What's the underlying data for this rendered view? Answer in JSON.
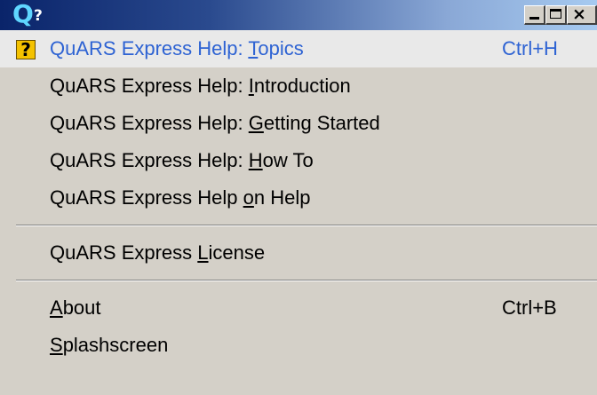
{
  "window": {
    "title": "?",
    "title_icon": "Q",
    "controls": {
      "minimize": "minimize-icon",
      "maximize": "maximize-icon",
      "close": "×"
    }
  },
  "menu": {
    "items": [
      {
        "pre": "QuARS Express Help: ",
        "mnemonic": "T",
        "post": "opics",
        "shortcut": "Ctrl+H",
        "icon": "help-icon",
        "icon_glyph": "?",
        "selected": true
      },
      {
        "pre": "QuARS Express Help: ",
        "mnemonic": "I",
        "post": "ntroduction",
        "shortcut": ""
      },
      {
        "pre": "QuARS Express Help: ",
        "mnemonic": "G",
        "post": "etting Started",
        "shortcut": ""
      },
      {
        "pre": "QuARS Express Help: ",
        "mnemonic": "H",
        "post": "ow To",
        "shortcut": ""
      },
      {
        "pre": "QuARS Express Help ",
        "mnemonic": "o",
        "post": "n Help",
        "shortcut": ""
      },
      {
        "pre": "QuARS Express ",
        "mnemonic": "L",
        "post": "icense",
        "shortcut": ""
      },
      {
        "pre": "",
        "mnemonic": "A",
        "post": "bout",
        "shortcut": "Ctrl+B"
      },
      {
        "pre": "",
        "mnemonic": "S",
        "post": "plashscreen",
        "shortcut": ""
      }
    ]
  },
  "colors": {
    "menu_background": "#d4d0c8",
    "selected_background": "#e9e9e9",
    "selected_text": "#2e63d3",
    "titlebar_start": "#0a246a",
    "titlebar_end": "#a6caf0"
  }
}
